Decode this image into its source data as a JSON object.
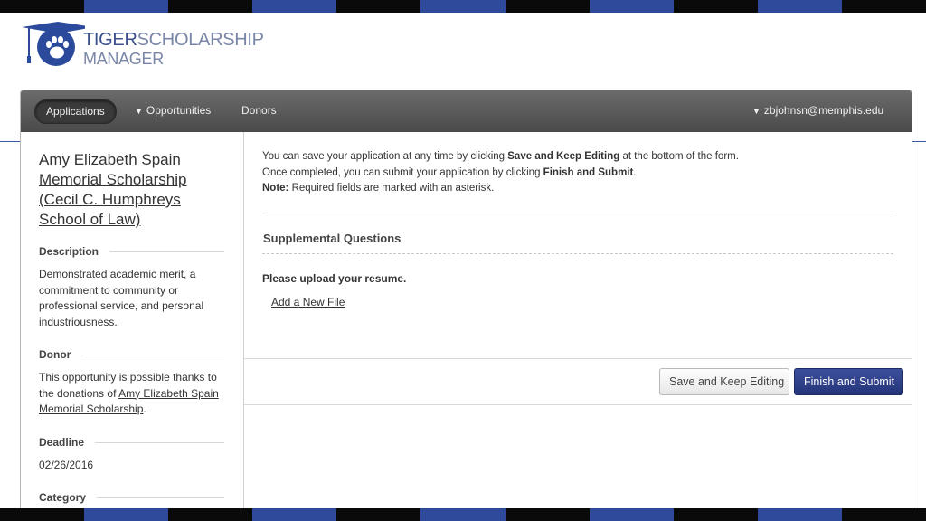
{
  "brand": {
    "logo_line1_bold": "TIGER",
    "logo_line1_thin": "SCHOLARSHIP",
    "logo_line2": "MANAGER"
  },
  "nav": {
    "items": [
      {
        "label": "Applications",
        "active": true,
        "caret": false
      },
      {
        "label": "Opportunities",
        "active": false,
        "caret": true
      },
      {
        "label": "Donors",
        "active": false,
        "caret": false
      }
    ],
    "user_email": "zbjohnsn@memphis.edu"
  },
  "sidebar": {
    "title": "Amy Elizabeth Spain Memorial Scholarship (Cecil C. Humphreys School of Law)",
    "description_heading": "Description",
    "description_text": "Demonstrated academic merit, a commitment to community or professional service, and personal industriousness.",
    "donor_heading": "Donor",
    "donor_text_prefix": "This opportunity is possible thanks to the donations of ",
    "donor_link": "Amy Elizabeth Spain Memorial Scholarship",
    "donor_text_suffix": ".",
    "deadline_heading": "Deadline",
    "deadline_value": "02/26/2016",
    "category_heading": "Category"
  },
  "content": {
    "intro_line1_a": "You can save your application at any time by clicking ",
    "intro_line1_b": "Save and Keep Editing",
    "intro_line1_c": " at the bottom of the form.",
    "intro_line2_a": "Once completed, you can submit your application by clicking ",
    "intro_line2_b": "Finish and Submit",
    "intro_line2_c": ".",
    "intro_line3_a": "Note:",
    "intro_line3_b": " Required fields are marked with an asterisk.",
    "section_title": "Supplemental Questions",
    "question": "Please upload your resume.",
    "add_file": "Add a New File"
  },
  "buttons": {
    "save": "Save and Keep Editing",
    "submit": "Finish and Submit"
  },
  "colors": {
    "accent": "#2b4a9c",
    "navbar": "#555555",
    "primary_button": "#2e3f88"
  }
}
